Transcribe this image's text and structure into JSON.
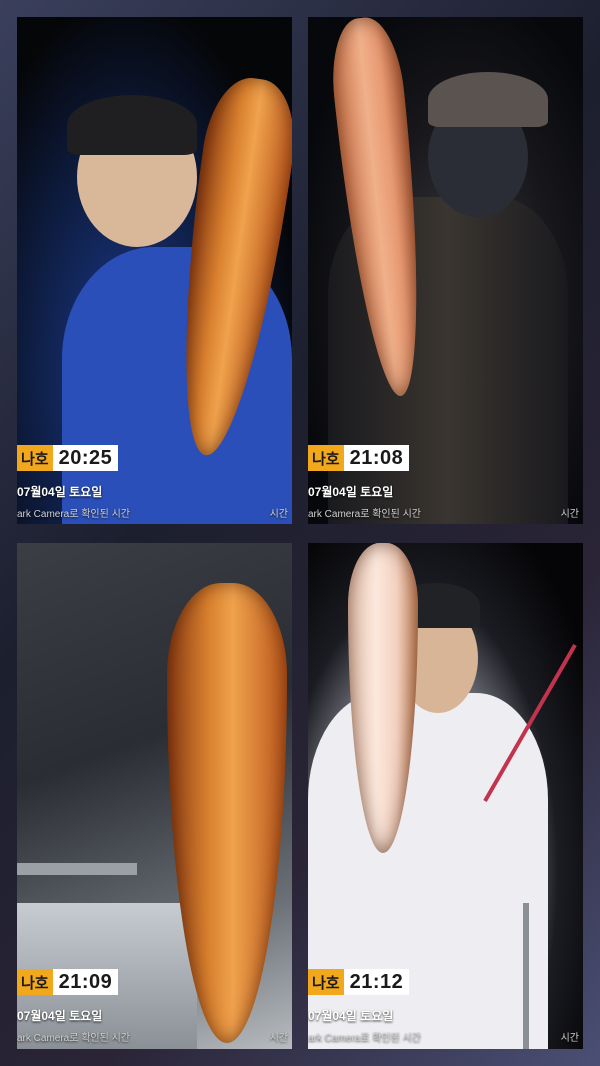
{
  "photos": [
    {
      "tag": "나호",
      "time": "20:25",
      "date": "07월04일 토요일",
      "caption": "ark Camera로 확인된 시간",
      "caption_right": "시간"
    },
    {
      "tag": "나호",
      "time": "21:08",
      "date": "07월04일 토요일",
      "caption": "ark Camera로 확인된 시간",
      "caption_right": "시간"
    },
    {
      "tag": "나호",
      "time": "21:09",
      "date": "07월04일 토요일",
      "caption": "ark Camera로 확인된 시간",
      "caption_right": "시간"
    },
    {
      "tag": "나호",
      "time": "21:12",
      "date": "07월04일 토요일",
      "caption": "ark Camera로 확인된 시간",
      "caption_right": "시간"
    }
  ]
}
